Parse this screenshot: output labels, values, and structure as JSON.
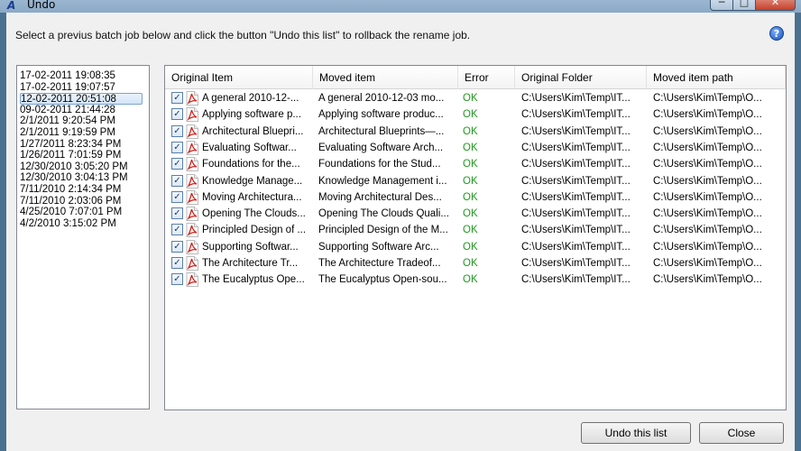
{
  "window": {
    "title": "Undo",
    "minimize": "─",
    "maximize": "□",
    "close": "✕"
  },
  "instruction": "Select a previus batch job below and click the button \"Undo this list\" to rollback the rename job.",
  "help_icon": "?",
  "dates": [
    "17-02-2011 19:08:35",
    "17-02-2011 19:07:57",
    "12-02-2011 20:51:08",
    "09-02-2011 21:44:28",
    "2/1/2011 9:20:54 PM",
    "2/1/2011 9:19:59 PM",
    "1/27/2011 8:23:34 PM",
    "1/26/2011 7:01:59 PM",
    "12/30/2010 3:05:20 PM",
    "12/30/2010 3:04:13 PM",
    "7/11/2010 2:14:34 PM",
    "7/11/2010 2:03:06 PM",
    "4/25/2010 7:07:01 PM",
    "4/2/2010 3:15:02 PM"
  ],
  "selected_date_index": 2,
  "columns": [
    "Original Item",
    "Moved item",
    "Error",
    "Original Folder",
    "Moved item path"
  ],
  "rows": [
    {
      "original": "A general 2010-12-...",
      "moved": "A general 2010-12-03 mo...",
      "error": "OK",
      "folder": "C:\\Users\\Kim\\Temp\\IT...",
      "path": "C:\\Users\\Kim\\Temp\\O..."
    },
    {
      "original": "Applying software p...",
      "moved": "Applying software produc...",
      "error": "OK",
      "folder": "C:\\Users\\Kim\\Temp\\IT...",
      "path": "C:\\Users\\Kim\\Temp\\O..."
    },
    {
      "original": "Architectural Bluepri...",
      "moved": "Architectural Blueprints—...",
      "error": "OK",
      "folder": "C:\\Users\\Kim\\Temp\\IT...",
      "path": "C:\\Users\\Kim\\Temp\\O..."
    },
    {
      "original": "Evaluating Softwar...",
      "moved": "Evaluating Software Arch...",
      "error": "OK",
      "folder": "C:\\Users\\Kim\\Temp\\IT...",
      "path": "C:\\Users\\Kim\\Temp\\O..."
    },
    {
      "original": "Foundations for the...",
      "moved": "Foundations for the Stud...",
      "error": "OK",
      "folder": "C:\\Users\\Kim\\Temp\\IT...",
      "path": "C:\\Users\\Kim\\Temp\\O..."
    },
    {
      "original": "Knowledge Manage...",
      "moved": "Knowledge Management i...",
      "error": "OK",
      "folder": "C:\\Users\\Kim\\Temp\\IT...",
      "path": "C:\\Users\\Kim\\Temp\\O..."
    },
    {
      "original": "Moving Architectura...",
      "moved": "Moving Architectural Des...",
      "error": "OK",
      "folder": "C:\\Users\\Kim\\Temp\\IT...",
      "path": "C:\\Users\\Kim\\Temp\\O..."
    },
    {
      "original": "Opening The Clouds...",
      "moved": "Opening The Clouds Quali...",
      "error": "OK",
      "folder": "C:\\Users\\Kim\\Temp\\IT...",
      "path": "C:\\Users\\Kim\\Temp\\O..."
    },
    {
      "original": "Principled Design of ...",
      "moved": "Principled Design of the M...",
      "error": "OK",
      "folder": "C:\\Users\\Kim\\Temp\\IT...",
      "path": "C:\\Users\\Kim\\Temp\\O..."
    },
    {
      "original": "Supporting Softwar...",
      "moved": "Supporting Software Arc...",
      "error": "OK",
      "folder": "C:\\Users\\Kim\\Temp\\IT...",
      "path": "C:\\Users\\Kim\\Temp\\O..."
    },
    {
      "original": "The Architecture Tr...",
      "moved": "The Architecture Tradeof...",
      "error": "OK",
      "folder": "C:\\Users\\Kim\\Temp\\IT...",
      "path": "C:\\Users\\Kim\\Temp\\O..."
    },
    {
      "original": "The Eucalyptus Ope...",
      "moved": "The Eucalyptus Open-sou...",
      "error": "OK",
      "folder": "C:\\Users\\Kim\\Temp\\IT...",
      "path": "C:\\Users\\Kim\\Temp\\O..."
    }
  ],
  "row_icon": "pdf-icon",
  "checkbox_mark": "✓",
  "buttons": {
    "undo": "Undo this list",
    "close": "Close"
  },
  "colors": {
    "ok": "#1e9a1e",
    "selection": "#d3e5f8",
    "pdf": "#d0211c"
  }
}
